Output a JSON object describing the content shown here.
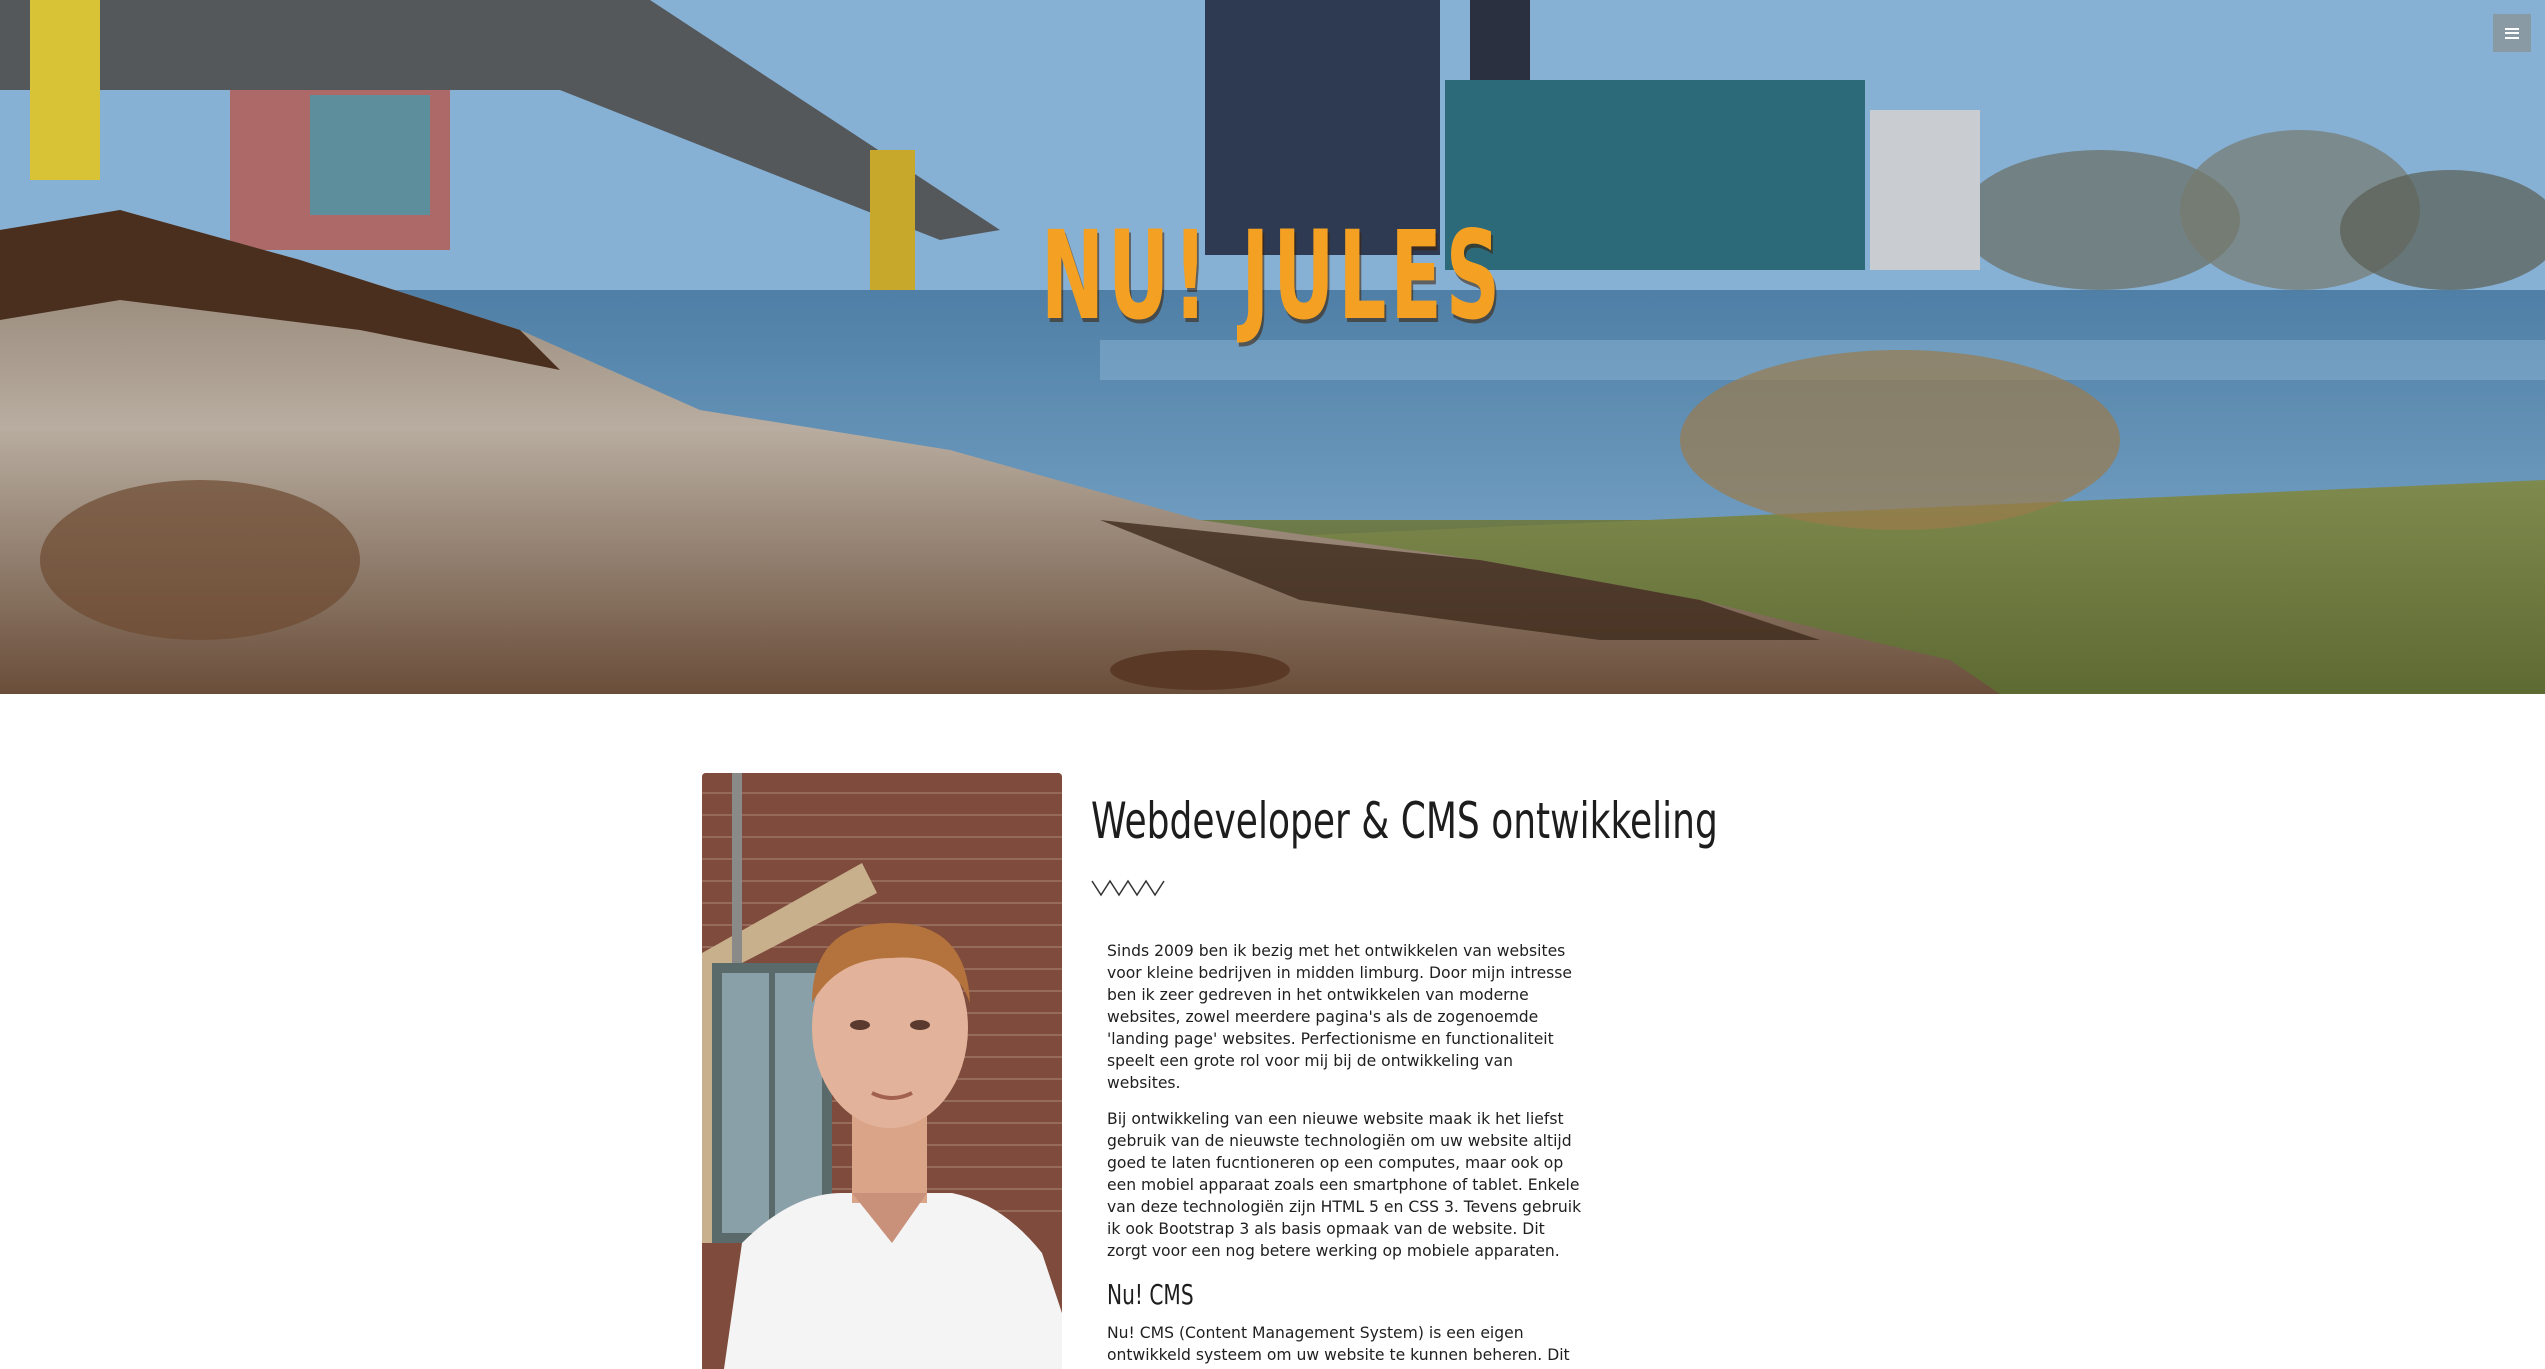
{
  "hero": {
    "title": "NU! JULES",
    "menu_icon": "hamburger-icon",
    "title_color": "#f3a023",
    "menu_button_color": "#8a9aa4"
  },
  "about": {
    "heading": "Webdeveloper & CMS ontwikkeling",
    "divider_icon": "zigzag-icon",
    "paragraphs": [
      "Sinds 2009 ben ik bezig met het ontwikkelen van websites voor kleine bedrijven in midden limburg. Door mijn intresse ben ik zeer gedreven in het ontwikkelen van moderne websites, zowel meerdere pagina's als de zogenoemde 'landing page' websites. Perfectionisme en functionaliteit speelt een grote rol voor mij bij de ontwikkeling van websites.",
      "Bij ontwikkeling van een nieuwe website maak ik het liefst gebruik van de nieuwste technologiën om uw website altijd goed te laten fucntioneren op een computes, maar ook op een mobiel apparaat zoals een smartphone of tablet. Enkele van deze technologiën zijn HTML 5 en CSS 3. Tevens gebruik ik ook Bootstrap 3 als basis opmaak van de website. Dit zorgt voor een nog betere werking op mobiele apparaten."
    ],
    "cms_heading": "Nu! CMS",
    "cms_paragraph": "Nu! CMS (Content Management System) is een eigen ontwikkeld systeem om uw website te kunnen beheren. Dit CMS kunt u gratis gebruiken bij uw website die door NuJules is ontwikkeld. De"
  }
}
